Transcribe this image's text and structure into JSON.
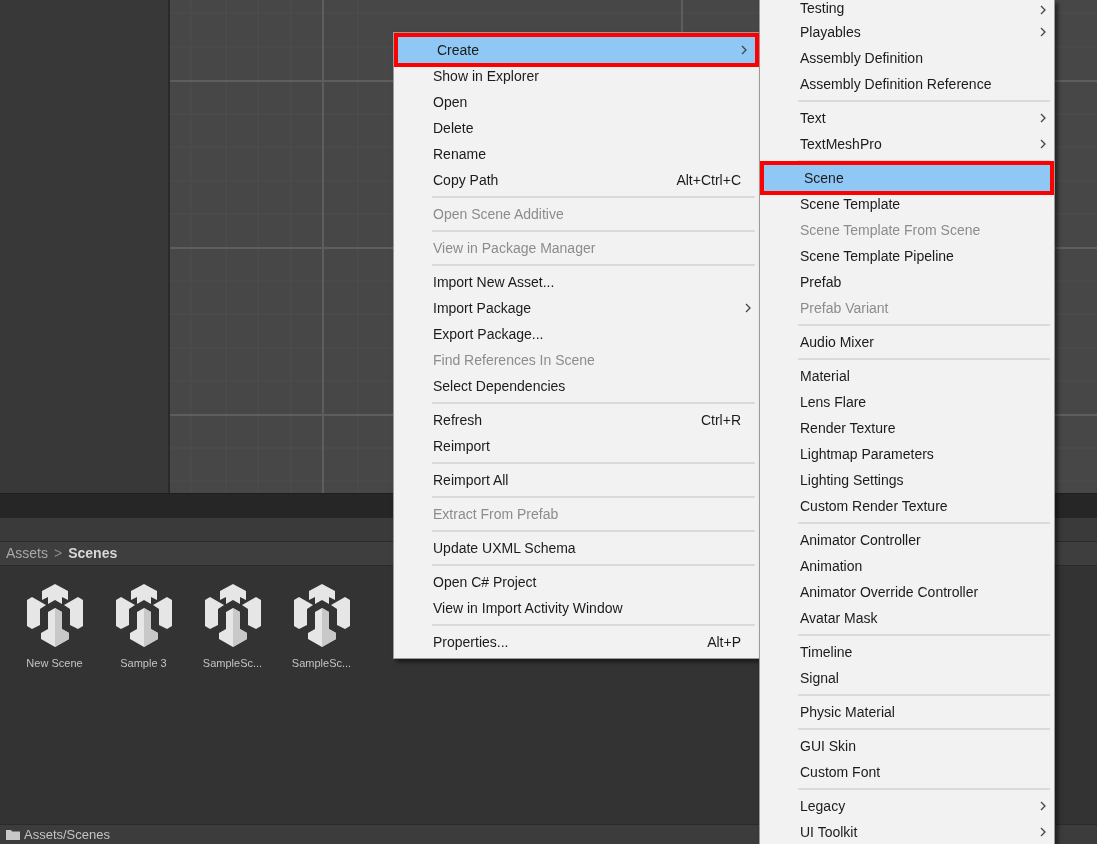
{
  "breadcrumb": {
    "parts": [
      "Assets",
      "Scenes"
    ],
    "separator": ">"
  },
  "assets": [
    {
      "name": "New Scene"
    },
    {
      "name": "Sample 3"
    },
    {
      "name": "SampleSc..."
    },
    {
      "name": "SampleSc..."
    }
  ],
  "status_bar": {
    "path": "Assets/Scenes"
  },
  "context_menu": {
    "sections": [
      [
        {
          "label": "Create",
          "submenu": true,
          "disabled": false,
          "selected": true
        },
        {
          "label": "Show in Explorer",
          "submenu": false,
          "disabled": false,
          "selected": false
        },
        {
          "label": "Open",
          "submenu": false,
          "disabled": false,
          "selected": false
        },
        {
          "label": "Delete",
          "submenu": false,
          "disabled": false,
          "selected": false
        },
        {
          "label": "Rename",
          "submenu": false,
          "disabled": false,
          "selected": false
        },
        {
          "label": "Copy Path",
          "shortcut": "Alt+Ctrl+C",
          "submenu": false,
          "disabled": false,
          "selected": false
        }
      ],
      [
        {
          "label": "Open Scene Additive",
          "submenu": false,
          "disabled": true,
          "selected": false
        }
      ],
      [
        {
          "label": "View in Package Manager",
          "submenu": false,
          "disabled": true,
          "selected": false
        }
      ],
      [
        {
          "label": "Import New Asset...",
          "submenu": false,
          "disabled": false,
          "selected": false
        },
        {
          "label": "Import Package",
          "submenu": true,
          "disabled": false,
          "selected": false
        },
        {
          "label": "Export Package...",
          "submenu": false,
          "disabled": false,
          "selected": false
        },
        {
          "label": "Find References In Scene",
          "submenu": false,
          "disabled": true,
          "selected": false
        },
        {
          "label": "Select Dependencies",
          "submenu": false,
          "disabled": false,
          "selected": false
        }
      ],
      [
        {
          "label": "Refresh",
          "shortcut": "Ctrl+R",
          "submenu": false,
          "disabled": false,
          "selected": false
        },
        {
          "label": "Reimport",
          "submenu": false,
          "disabled": false,
          "selected": false
        }
      ],
      [
        {
          "label": "Reimport All",
          "submenu": false,
          "disabled": false,
          "selected": false
        }
      ],
      [
        {
          "label": "Extract From Prefab",
          "submenu": false,
          "disabled": true,
          "selected": false
        }
      ],
      [
        {
          "label": "Update UXML Schema",
          "submenu": false,
          "disabled": false,
          "selected": false
        }
      ],
      [
        {
          "label": "Open C# Project",
          "submenu": false,
          "disabled": false,
          "selected": false
        },
        {
          "label": "View in Import Activity Window",
          "submenu": false,
          "disabled": false,
          "selected": false
        }
      ],
      [
        {
          "label": "Properties...",
          "shortcut": "Alt+P",
          "submenu": false,
          "disabled": false,
          "selected": false
        }
      ]
    ]
  },
  "create_submenu": {
    "sections": [
      [
        {
          "label": "Testing",
          "submenu": true,
          "disabled": false,
          "selected": false
        },
        {
          "label": "Playables",
          "submenu": true,
          "disabled": false,
          "selected": false
        },
        {
          "label": "Assembly Definition",
          "submenu": false,
          "disabled": false,
          "selected": false
        },
        {
          "label": "Assembly Definition Reference",
          "submenu": false,
          "disabled": false,
          "selected": false
        }
      ],
      [
        {
          "label": "Text",
          "submenu": true,
          "disabled": false,
          "selected": false
        },
        {
          "label": "TextMeshPro",
          "submenu": true,
          "disabled": false,
          "selected": false
        }
      ],
      [
        {
          "label": "Scene",
          "submenu": false,
          "disabled": false,
          "selected": true
        },
        {
          "label": "Scene Template",
          "submenu": false,
          "disabled": false,
          "selected": false
        },
        {
          "label": "Scene Template From Scene",
          "submenu": false,
          "disabled": true,
          "selected": false
        },
        {
          "label": "Scene Template Pipeline",
          "submenu": false,
          "disabled": false,
          "selected": false
        },
        {
          "label": "Prefab",
          "submenu": false,
          "disabled": false,
          "selected": false
        },
        {
          "label": "Prefab Variant",
          "submenu": false,
          "disabled": true,
          "selected": false
        }
      ],
      [
        {
          "label": "Audio Mixer",
          "submenu": false,
          "disabled": false,
          "selected": false
        }
      ],
      [
        {
          "label": "Material",
          "submenu": false,
          "disabled": false,
          "selected": false
        },
        {
          "label": "Lens Flare",
          "submenu": false,
          "disabled": false,
          "selected": false
        },
        {
          "label": "Render Texture",
          "submenu": false,
          "disabled": false,
          "selected": false
        },
        {
          "label": "Lightmap Parameters",
          "submenu": false,
          "disabled": false,
          "selected": false
        },
        {
          "label": "Lighting Settings",
          "submenu": false,
          "disabled": false,
          "selected": false
        },
        {
          "label": "Custom Render Texture",
          "submenu": false,
          "disabled": false,
          "selected": false
        }
      ],
      [
        {
          "label": "Animator Controller",
          "submenu": false,
          "disabled": false,
          "selected": false
        },
        {
          "label": "Animation",
          "submenu": false,
          "disabled": false,
          "selected": false
        },
        {
          "label": "Animator Override Controller",
          "submenu": false,
          "disabled": false,
          "selected": false
        },
        {
          "label": "Avatar Mask",
          "submenu": false,
          "disabled": false,
          "selected": false
        }
      ],
      [
        {
          "label": "Timeline",
          "submenu": false,
          "disabled": false,
          "selected": false
        },
        {
          "label": "Signal",
          "submenu": false,
          "disabled": false,
          "selected": false
        }
      ],
      [
        {
          "label": "Physic Material",
          "submenu": false,
          "disabled": false,
          "selected": false
        }
      ],
      [
        {
          "label": "GUI Skin",
          "submenu": false,
          "disabled": false,
          "selected": false
        },
        {
          "label": "Custom Font",
          "submenu": false,
          "disabled": false,
          "selected": false
        }
      ],
      [
        {
          "label": "Legacy",
          "submenu": true,
          "disabled": false,
          "selected": false
        },
        {
          "label": "UI Toolkit",
          "submenu": true,
          "disabled": false,
          "selected": false
        }
      ]
    ]
  }
}
